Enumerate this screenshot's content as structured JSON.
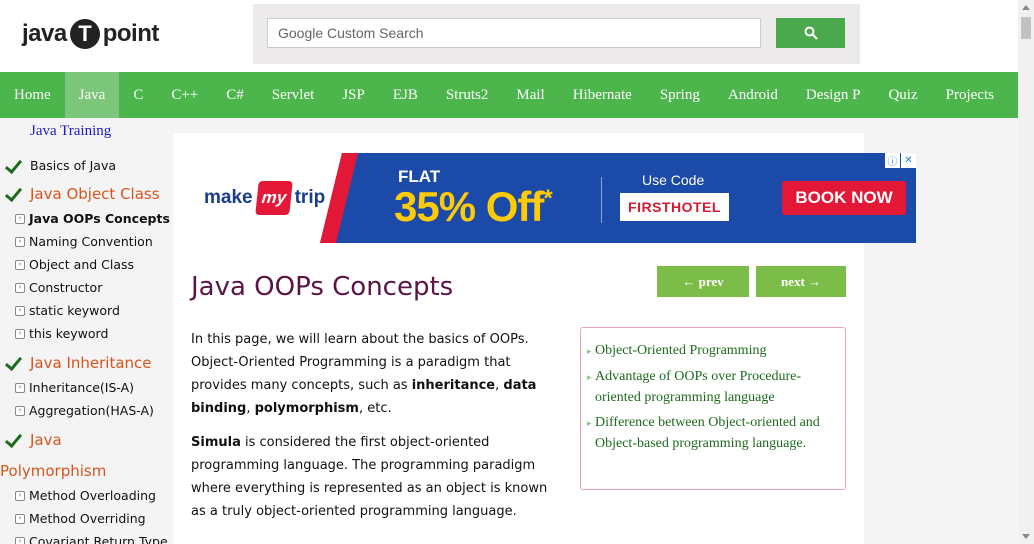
{
  "header": {
    "logo_left": "java",
    "logo_mid": "T",
    "logo_right": "point",
    "search_placeholder": "Google Custom Search"
  },
  "nav": {
    "items": [
      "Home",
      "Java",
      "C",
      "C++",
      "C#",
      "Servlet",
      "JSP",
      "EJB",
      "Struts2",
      "Mail",
      "Hibernate",
      "Spring",
      "Android",
      "Design P",
      "Quiz",
      "Projects"
    ],
    "active": "Java"
  },
  "sidebar": {
    "heading": "Java Training",
    "items": [
      {
        "label": "Basics of Java",
        "style": "tick-main"
      },
      {
        "label": "Java Object Class",
        "style": "tick-orange"
      },
      {
        "label": "Java OOPs Concepts",
        "style": "sub-bold"
      },
      {
        "label": "Naming Convention",
        "style": "sub"
      },
      {
        "label": "Object and Class",
        "style": "sub"
      },
      {
        "label": "Constructor",
        "style": "sub"
      },
      {
        "label": "static keyword",
        "style": "sub"
      },
      {
        "label": "this keyword",
        "style": "sub"
      },
      {
        "label": "Java Inheritance",
        "style": "tick-orange"
      },
      {
        "label": "Inheritance(IS-A)",
        "style": "sub"
      },
      {
        "label": "Aggregation(HAS-A)",
        "style": "sub"
      },
      {
        "label": "Java",
        "style": "tick-orange"
      },
      {
        "label": "Polymorphism",
        "style": "orange-cont"
      },
      {
        "label": "Method Overloading",
        "style": "sub"
      },
      {
        "label": "Method Overriding",
        "style": "sub"
      },
      {
        "label": "Covariant Return Type",
        "style": "sub"
      }
    ]
  },
  "ad": {
    "brand_left": "make",
    "brand_mid": "my",
    "brand_right": "trip",
    "flat": "FLAT",
    "offer": "35% Off",
    "asterisk": "*",
    "use_code_label": "Use Code",
    "code": "FIRSTHOTEL",
    "cta": "BOOK NOW",
    "info_icon": "ⓘ",
    "close_icon": "✕"
  },
  "main": {
    "title": "Java OOPs Concepts",
    "prev_label": "← prev",
    "next_label": "next →",
    "p1_parts": [
      "In this page, we will learn about the basics of OOPs. Object-Oriented Programming is a paradigm that provides many concepts, such as ",
      "inheritance",
      ", ",
      "data binding",
      ", ",
      "polymorphism",
      ", etc."
    ],
    "p2_parts": [
      "Simula",
      " is considered the first object-oriented programming language. The programming paradigm where everything is represented as an object is known as a truly object-oriented programming language."
    ],
    "toc": [
      "Object-Oriented Programming",
      "Advantage of OOPs over Procedure-oriented programming language",
      "Difference between Object-oriented and Object-based programming language."
    ]
  },
  "colors": {
    "nav_green": "#4CB64C",
    "nav_active": "#7BC67B",
    "title_purple": "#5a1446",
    "sidebar_orange": "#d9541c",
    "button_green": "#7cbd4a"
  }
}
